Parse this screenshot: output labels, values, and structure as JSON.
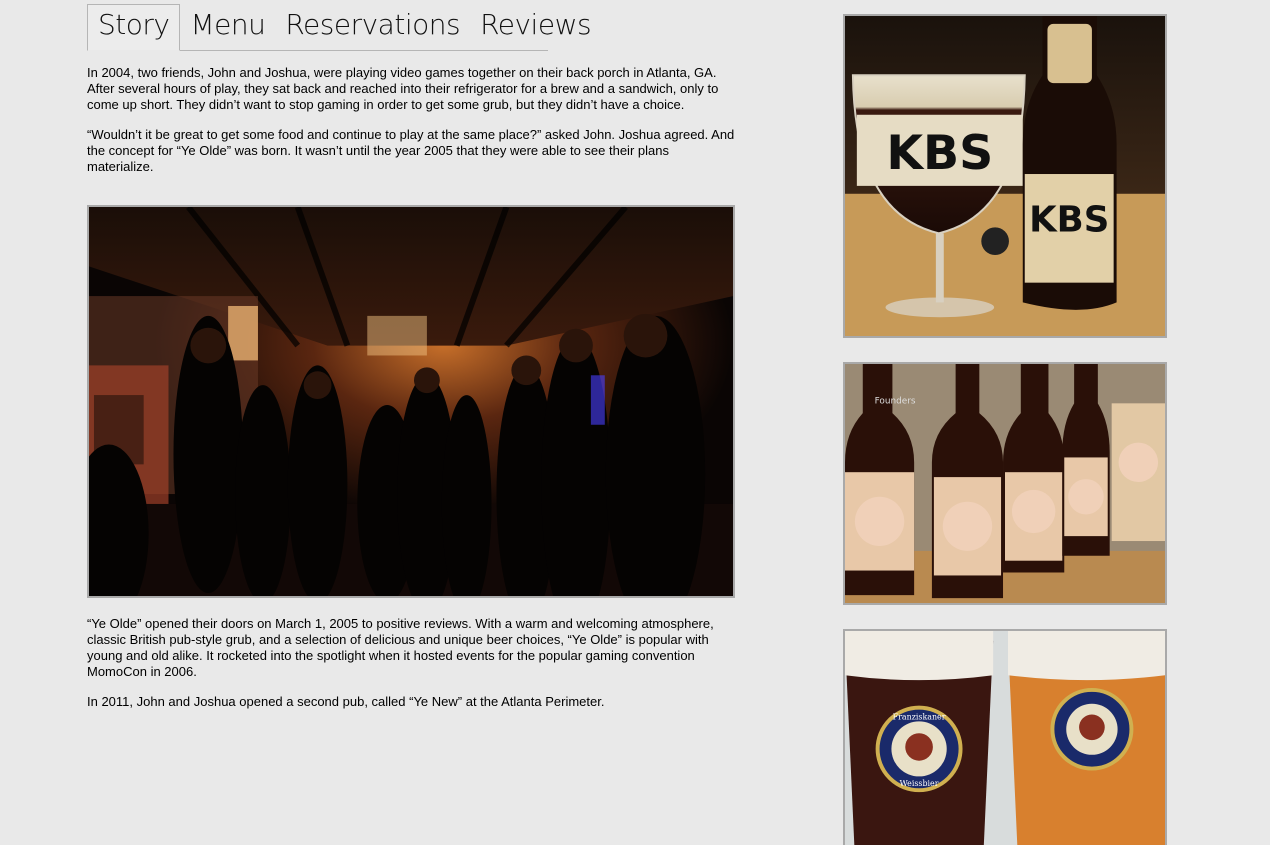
{
  "tabs": [
    {
      "label": "Story"
    },
    {
      "label": "Menu"
    },
    {
      "label": "Reservations"
    },
    {
      "label": "Reviews"
    }
  ],
  "story": {
    "p1": "In 2004, two friends, John and Joshua, were playing video games together on their back porch in Atlanta, GA. After several hours of play, they sat back and reached into their refrigerator for a brew and a sandwich, only to come up short. They didn’t want to stop gaming in order to get some grub, but they didn’t have a choice.",
    "p2": "“Wouldn’t it be great to get some food and continue to play at the same place?” asked John. Joshua agreed. And the concept for “Ye Olde” was born. It wasn’t until the year 2005 that they were able to see their plans materialize.",
    "p3": "“Ye Olde” opened their doors on March 1, 2005 to positive reviews. With a warm and welcoming atmosphere, classic British pub-style grub, and a selection of delicious and unique beer choices, “Ye Olde” is popular with young and old alike. It rocketed into the spotlight when it hosted events for the popular gaming convention MomoCon in 2006.",
    "p4": "In 2011, John and Joshua opened a second pub, called “Ye New” at the Atlanta Perimeter."
  },
  "photos": {
    "kbs_text": "KBS",
    "kbs_bottle_text": "KBS",
    "founders_label": "Founders",
    "franziskaner_label": "Franziskaner",
    "weissbier_label": "Weissbier"
  }
}
